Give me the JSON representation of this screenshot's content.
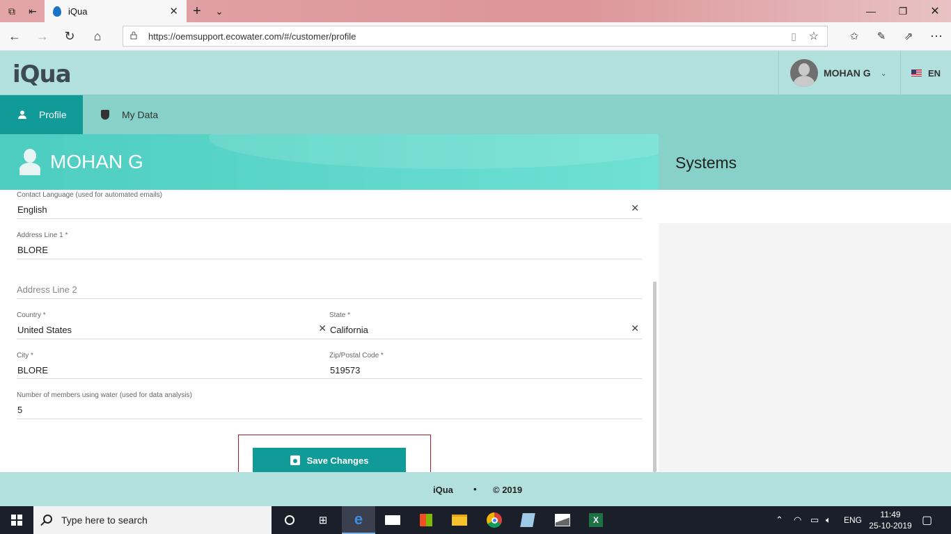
{
  "browser": {
    "tab_title": "iQua",
    "url": "https://oemsupport.ecowater.com/#/customer/profile"
  },
  "header": {
    "logo": "iQua",
    "user_name": "MOHAN G",
    "language": "EN"
  },
  "nav": {
    "tabs": [
      {
        "label": "Profile",
        "active": true
      },
      {
        "label": "My Data",
        "active": false
      }
    ]
  },
  "profile": {
    "name": "MOHAN G"
  },
  "systems": {
    "title": "Systems"
  },
  "form": {
    "contact_language": {
      "label": "Contact Language (used for automated emails)",
      "value": "English"
    },
    "address1": {
      "label": "Address Line 1 *",
      "value": "BLORE"
    },
    "address2": {
      "placeholder": "Address Line 2"
    },
    "country": {
      "label": "Country *",
      "value": "United States"
    },
    "state": {
      "label": "State *",
      "value": "California"
    },
    "city": {
      "label": "City *",
      "value": "BLORE"
    },
    "zip": {
      "label": "Zip/Postal Code *",
      "value": "519573"
    },
    "members": {
      "label": "Number of members using water (used for data analysis)",
      "value": "5"
    },
    "save_label": "Save Changes"
  },
  "footer": {
    "brand": "iQua",
    "separator": "•",
    "copyright": "© 2019"
  },
  "taskbar": {
    "search_placeholder": "Type here to search",
    "language": "ENG",
    "time": "11:49",
    "date": "25-10-2019"
  },
  "colors": {
    "accent": "#109a98",
    "header_bg": "#b2e0dc",
    "nav_bg": "#87d1c8",
    "highlight_border": "#b21a2a"
  }
}
